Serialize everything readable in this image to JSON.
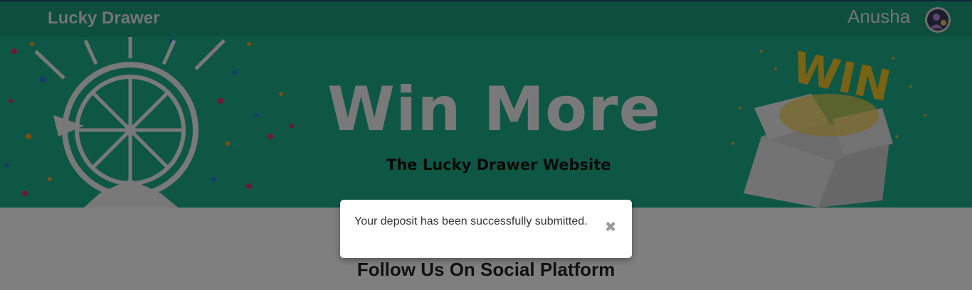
{
  "navbar": {
    "brand": "Lucky Drawer",
    "username": "Anusha",
    "avatar_icon": "user-avatar-icon"
  },
  "hero": {
    "title": "Win More",
    "subtitle": "The Lucky Drawer Website",
    "left_art_icon": "prize-wheel-icon",
    "right_art_icon": "gift-box-icon",
    "right_art_text": "WIN"
  },
  "section": {
    "heading": "Follow Us On Social Platform"
  },
  "modal": {
    "message": "Your deposit has been successfully submitted.",
    "close_glyph": "✖",
    "close_icon": "close-icon"
  },
  "colors": {
    "navbar": "#1a9c78",
    "hero_background": "#1fae8a",
    "overlay": "rgba(0,0,0,0.5)"
  }
}
